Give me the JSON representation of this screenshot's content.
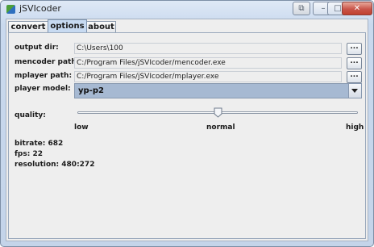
{
  "window": {
    "title": "jSVIcoder",
    "icon": "app-icon",
    "controls": [
      "restore-icon",
      "minimize-icon",
      "maximize-icon",
      "close-icon"
    ]
  },
  "tabs": [
    {
      "label": "convert",
      "selected": false
    },
    {
      "label": "options",
      "selected": true
    },
    {
      "label": "about",
      "selected": false
    }
  ],
  "options": {
    "output_dir": {
      "label": "output dir:",
      "value": "C:\\Users\\100",
      "button": "..."
    },
    "mencoder_path": {
      "label": "mencoder path:",
      "value": "C:/Program Files/jSVIcoder/mencoder.exe",
      "button": "..."
    },
    "mplayer_path": {
      "label": "mplayer path:",
      "value": "C:/Program Files/jSVIcoder/mplayer.exe",
      "button": "..."
    },
    "player_model": {
      "label": "player model:",
      "value": "yp-p2"
    },
    "quality": {
      "label": "quality:",
      "level": 0.5,
      "ticks": {
        "low": "low",
        "normal": "normal",
        "high": "high"
      }
    }
  },
  "stats": {
    "bitrate": "bitrate: 682",
    "fps": "fps: 22",
    "resolution": "resolution: 480:272"
  },
  "colors": {
    "selected_tab": "#c7daf1",
    "combo_background": "#a6b9d2",
    "close_button": "#c9554a"
  }
}
